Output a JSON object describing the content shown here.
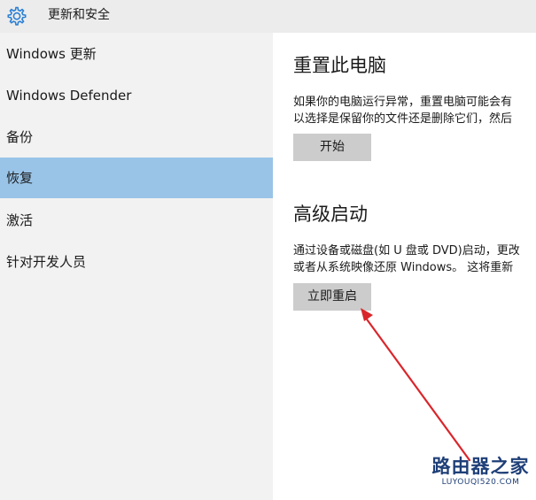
{
  "header": {
    "icon": "gear-icon",
    "title": "更新和安全"
  },
  "sidebar": {
    "items": [
      {
        "label": "Windows 更新",
        "active": false
      },
      {
        "label": "Windows Defender",
        "active": false
      },
      {
        "label": "备份",
        "active": false
      },
      {
        "label": "恢复",
        "active": true
      },
      {
        "label": "激活",
        "active": false
      },
      {
        "label": "针对开发人员",
        "active": false
      }
    ],
    "active_color": "#99c4e8"
  },
  "main": {
    "reset": {
      "title": "重置此电脑",
      "description_line1": "如果你的电脑运行异常，重置电脑可能会有",
      "description_line2": "以选择是保留你的文件还是删除它们，然后",
      "button_label": "开始"
    },
    "advanced_startup": {
      "title": "高级启动",
      "description_line1": "通过设备或磁盘(如 U 盘或 DVD)启动，更改",
      "description_line2": "或者从系统映像还原 Windows。 这将重新",
      "button_label": "立即重启"
    }
  },
  "annotation": {
    "arrow_color": "#d9262c"
  },
  "watermark": {
    "main": "路由器之家",
    "sub": "LUYOUQI520.COM"
  }
}
